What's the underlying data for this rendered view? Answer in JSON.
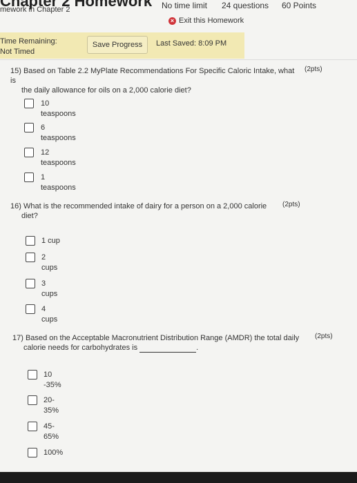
{
  "header": {
    "title": "Chapter 2 Homework",
    "breadcrumb": "mework in Chapter 2",
    "time_limit": "No time limit",
    "question_count": "24 questions",
    "points": "60 Points",
    "exit_label": "Exit this Homework"
  },
  "status": {
    "time_label": "Time Remaining:",
    "time_value": "Not Timed",
    "save_label": "Save Progress",
    "last_saved": "Last Saved: 8:09 PM"
  },
  "questions": [
    {
      "number": "15)",
      "text_line1": "Based on Table 2.2 MyPlate Recommendations For Specific Caloric Intake, what is",
      "text_line2": "the daily allowance for oils on a 2,000 calorie diet?",
      "points": "(2pts)",
      "options": [
        {
          "line1": "10",
          "line2": "teaspoons"
        },
        {
          "line1": "6",
          "line2": "teaspoons"
        },
        {
          "line1": "12",
          "line2": "teaspoons"
        },
        {
          "line1": "1",
          "line2": "teaspoons"
        }
      ]
    },
    {
      "number": "16)",
      "text_line1": "What is the recommended intake of dairy for a person on a 2,000 calorie",
      "text_line2": "diet?",
      "points": "(2pts)",
      "options": [
        {
          "line1": "1 cup",
          "line2": ""
        },
        {
          "line1": "2",
          "line2": "cups"
        },
        {
          "line1": "3",
          "line2": "cups"
        },
        {
          "line1": "4",
          "line2": "cups"
        }
      ]
    },
    {
      "number": "17)",
      "text_line1": "Based on the Acceptable Macronutrient Distribution Range (AMDR) the total daily",
      "text_line2": "calorie needs for carbohydrates is",
      "text_suffix": ".",
      "points": "(2pts)",
      "options": [
        {
          "line1": "10",
          "line2": "-35%"
        },
        {
          "line1": "20-",
          "line2": "35%"
        },
        {
          "line1": "45-",
          "line2": "65%"
        },
        {
          "line1": "100%",
          "line2": ""
        }
      ]
    }
  ]
}
